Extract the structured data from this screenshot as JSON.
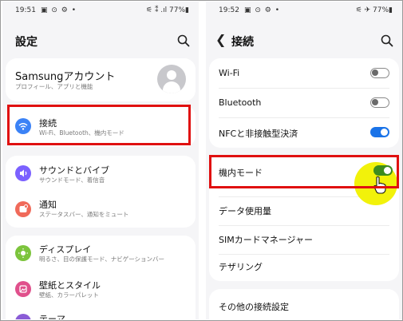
{
  "left": {
    "status": {
      "time": "19:51",
      "icons_left": "▣ ⊙ ⚙ •",
      "icons_right": "⚟ ⁑ .ıl 77%▮"
    },
    "title": "設定",
    "account": {
      "title": "Samsungアカウント",
      "subtitle": "プロフィール、アプリと機能"
    },
    "items": [
      {
        "title": "接続",
        "subtitle": "Wi-Fi、Bluetooth、機内モード",
        "icon": "wifi-icon",
        "color": "#3b82f6"
      },
      {
        "title": "サウンドとバイブ",
        "subtitle": "サウンドモード、着信音",
        "icon": "sound-icon",
        "color": "#7b61ff"
      },
      {
        "title": "通知",
        "subtitle": "ステータスバー、通知をミュート",
        "icon": "notification-icon",
        "color": "#f06a5a"
      },
      {
        "title": "ディスプレイ",
        "subtitle": "明るさ、目の保護モード、ナビゲーションバー",
        "icon": "display-icon",
        "color": "#7cc43c"
      },
      {
        "title": "壁紙とスタイル",
        "subtitle": "壁紙、カラーパレット",
        "icon": "wallpaper-icon",
        "color": "#e0508c"
      },
      {
        "title": "テーマ",
        "subtitle": "",
        "icon": "theme-icon",
        "color": "#8a5cd6"
      }
    ]
  },
  "right": {
    "status": {
      "time": "19:52",
      "icons_left": "▣ ⊙ ⚙ •",
      "icons_right": "⚟ ✈ 77%▮"
    },
    "title": "接続",
    "rows": [
      {
        "label": "Wi-Fi",
        "toggle": "off"
      },
      {
        "label": "Bluetooth",
        "toggle": "off"
      },
      {
        "label": "NFCと非接触型決済",
        "toggle": "on"
      },
      {
        "label": "機内モード",
        "toggle": "on"
      },
      {
        "label": "データ使用量"
      },
      {
        "label": "SIMカードマネージャー"
      },
      {
        "label": "テザリング"
      },
      {
        "label": "その他の接続設定"
      }
    ]
  },
  "colors": {
    "highlight": "#e01010",
    "toggle_on": "#1a73e8",
    "airplane_toggle": "#3c8c1e",
    "cursor_circle": "#f2f20a"
  }
}
